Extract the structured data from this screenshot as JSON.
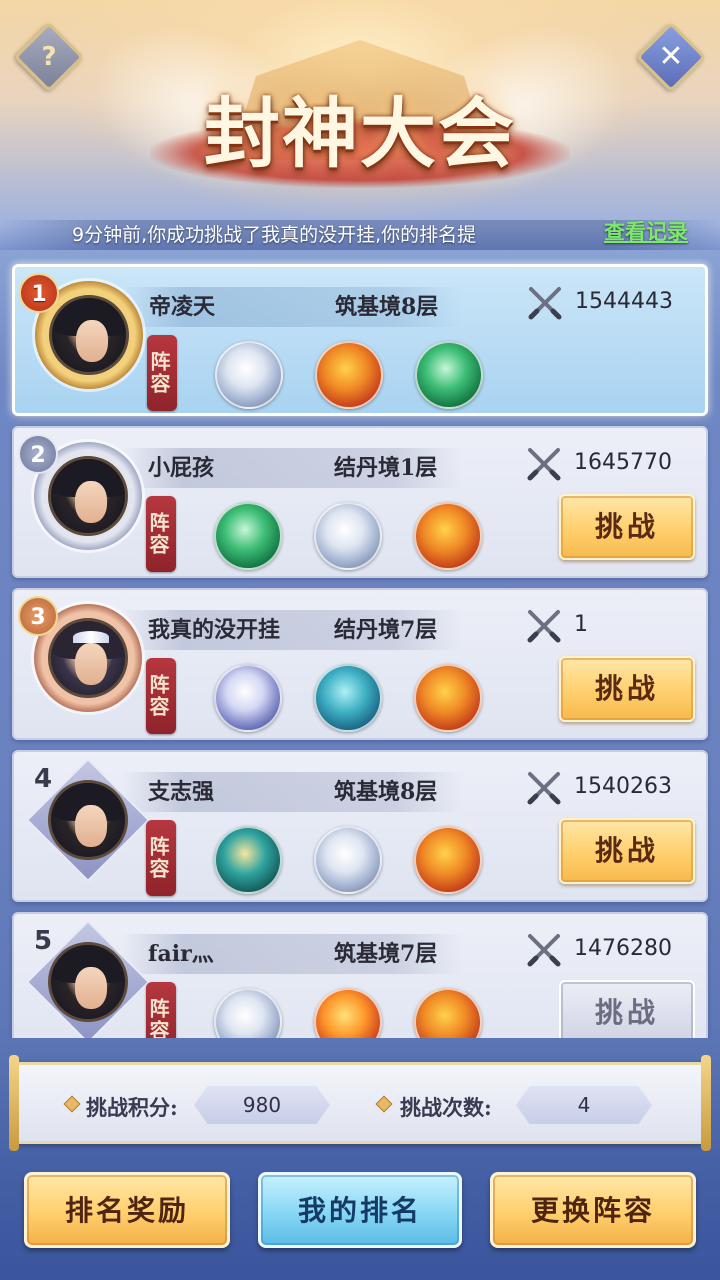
{
  "header": {
    "title": "封神大会",
    "help_glyph": "?",
    "close_glyph": "✕"
  },
  "notice": {
    "text": "9分钟前,你成功挑战了我真的没开挂,你的排名提",
    "record_link": "查看记录"
  },
  "lineup_label": "阵容",
  "challenge_label": "挑战",
  "players": [
    {
      "rank": "1",
      "name": "帝凌天",
      "realm": "筑基境8层",
      "power": "1544443",
      "is_self": true,
      "pets": [
        "white-tiger",
        "orange-dragon",
        "green-dragon"
      ]
    },
    {
      "rank": "2",
      "name": "小屁孩",
      "realm": "结丹境1层",
      "power": "1645770",
      "is_self": false,
      "pets": [
        "green-dragon",
        "white-tiger",
        "orange-dragon"
      ]
    },
    {
      "rank": "3",
      "name": "我真的没开挂",
      "realm": "结丹境7层",
      "power": "1",
      "is_self": false,
      "pets": [
        "frost-wolf",
        "sea-whale",
        "orange-dragon"
      ]
    },
    {
      "rank": "4",
      "name": "支志强",
      "realm": "筑基境8层",
      "power": "1540263",
      "is_self": false,
      "pets": [
        "teal-beast",
        "white-tiger",
        "orange-dragon"
      ]
    },
    {
      "rank": "5",
      "name": "fair灬",
      "realm": "筑基境7层",
      "power": "1476280",
      "is_self": false,
      "pets": [
        "white-tiger",
        "phoenix",
        "orange-dragon"
      ]
    }
  ],
  "stats": {
    "points_label": "挑战积分:",
    "points_value": "980",
    "count_label": "挑战次数:",
    "count_value": "4"
  },
  "buttons": {
    "rank_reward": "排名奖励",
    "my_rank": "我的排名",
    "change_lineup": "更换阵容"
  },
  "icons": {
    "help": "question-icon",
    "close": "close-icon",
    "power": "crossed-swords-icon",
    "stat": "diamond-icon"
  },
  "colors": {
    "record_link": "#7de86e",
    "self_card": "#a9d3f1",
    "lineup_tag": "#b6373f",
    "challenge_button": "#ffcf6d"
  }
}
